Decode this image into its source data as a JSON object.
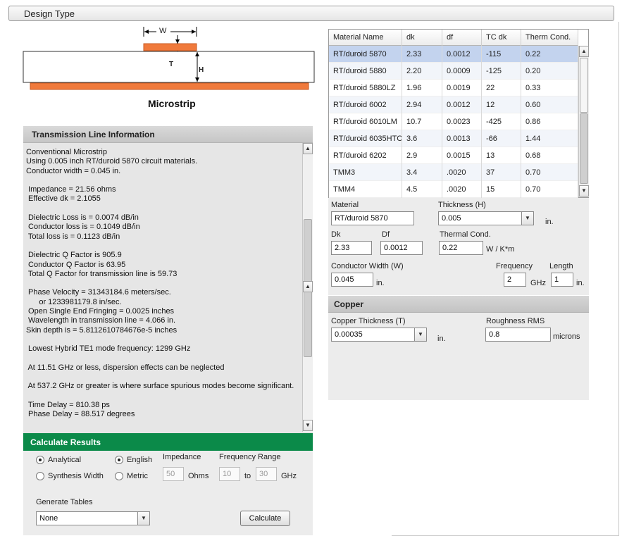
{
  "design_type": {
    "label": "Design Type"
  },
  "diagram": {
    "w_label": "W",
    "t_label": "T",
    "h_label": "H",
    "title": "Microstrip",
    "strip_color": "#f07a3c"
  },
  "transmission_line": {
    "header": "Transmission Line Information",
    "lines": [
      "Conventional Microstrip",
      "Using 0.005 inch RT/duroid 5870 circuit materials.",
      "Conductor width = 0.045 in.",
      "",
      " Impedance = 21.56 ohms",
      " Effective dk = 2.1055",
      "",
      " Dielectric Loss is = 0.0074 dB/in",
      " Conductor loss is = 0.1049 dB/in",
      " Total loss is = 0.1123 dB/in",
      "",
      " Dielectric Q Factor is 905.9",
      " Conductor Q Factor is 63.95",
      " Total Q Factor for transmission line is 59.73",
      "",
      " Phase Velocity = 31343184.6 meters/sec.",
      "      or 1233981179.8 in/sec.",
      " Open Single End Fringing = 0.0025 inches",
      " Wavelength in transmission line = 4.066 in.",
      "Skin depth is = 5.8112610784676e-5 inches",
      "",
      " Lowest Hybrid TE1 mode frequency: 1299 GHz",
      "",
      " At 11.51 GHz or less, dispersion effects can be neglected",
      "",
      " At 537.2 GHz or greater is where surface spurious modes become significant.",
      "",
      " Time Delay = 810.38 ps",
      " Phase Delay = 88.517 degrees"
    ]
  },
  "calculate": {
    "header": "Calculate Results",
    "header_color": "#0b8a49",
    "analytical": "Analytical",
    "synthesis": "Synthesis Width",
    "english": "English",
    "metric": "Metric",
    "impedance_label": "Impedance",
    "impedance_value": "50",
    "ohms": "Ohms",
    "freq_range_label": "Frequency Range",
    "freq_from": "10",
    "to": "to",
    "freq_to": "30",
    "ghz": "GHz",
    "generate_tables_label": "Generate Tables",
    "generate_tables_value": "None",
    "calculate_button": "Calculate"
  },
  "materials": {
    "columns": [
      "Material Name",
      "dk",
      "df",
      "TC dk",
      "Therm Cond."
    ],
    "rows": [
      [
        "RT/duroid 5870",
        "2.33",
        "0.0012",
        "-115",
        "0.22"
      ],
      [
        "RT/duroid 5880",
        "2.20",
        "0.0009",
        "-125",
        "0.20"
      ],
      [
        "RT/duroid 5880LZ",
        "1.96",
        "0.0019",
        "22",
        "0.33"
      ],
      [
        "RT/duroid 6002",
        "2.94",
        "0.0012",
        "12",
        "0.60"
      ],
      [
        "RT/duroid 6010LM",
        "10.7",
        "0.0023",
        "-425",
        "0.86"
      ],
      [
        "RT/duroid 6035HTC",
        "3.6",
        "0.0013",
        "-66",
        "1.44"
      ],
      [
        "RT/duroid 6202",
        "2.9",
        "0.0015",
        "13",
        "0.68"
      ],
      [
        "TMM3",
        "3.4",
        ".0020",
        "37",
        "0.70"
      ],
      [
        "TMM4",
        "4.5",
        ".0020",
        "15",
        "0.70"
      ]
    ],
    "selected_row": 0,
    "selected_color": "#c3d3ee"
  },
  "properties": {
    "material_label": "Material",
    "material_value": "RT/duroid 5870",
    "thickness_label": "Thickness (H)",
    "thickness_value": "0.005",
    "thickness_unit": "in.",
    "dk_label": "Dk",
    "dk_value": "2.33",
    "df_label": "Df",
    "df_value": "0.0012",
    "thermal_label": "Thermal Cond.",
    "thermal_value": "0.22",
    "thermal_unit": "W / K*m",
    "cond_width_label": "Conductor Width (W)",
    "cond_width_value": "0.045",
    "cond_width_unit": "in.",
    "frequency_label": "Frequency",
    "frequency_value": "2",
    "frequency_unit": "GHz",
    "length_label": "Length",
    "length_value": "1",
    "length_unit": "in."
  },
  "copper": {
    "header": "Copper",
    "thickness_label": "Copper Thickness (T)",
    "thickness_value": "0.00035",
    "thickness_unit": "in.",
    "roughness_label": "Roughness RMS",
    "roughness_value": "0.8",
    "roughness_unit": "microns"
  }
}
